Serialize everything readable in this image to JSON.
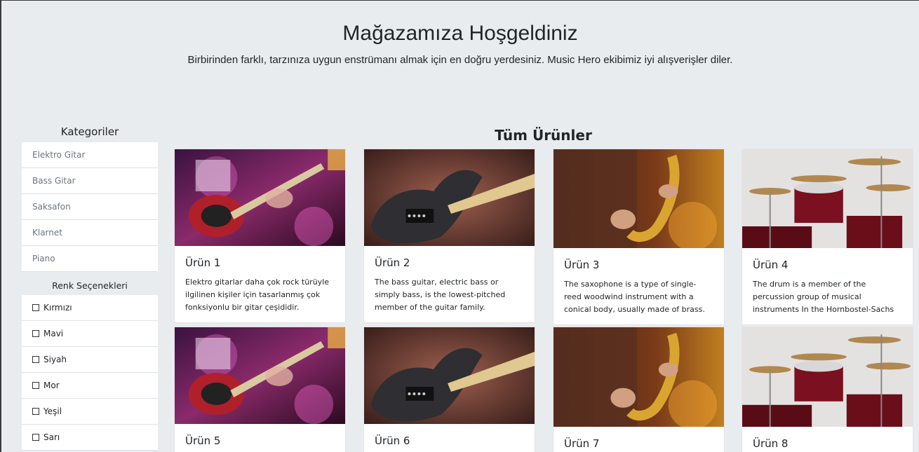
{
  "hero": {
    "title": "Mağazamıza Hoşgeldiniz",
    "subtitle": "Birbirinden farklı, tarzınıza uygun enstrümanı almak için en doğru yerdesiniz. Music Hero ekibimiz iyi alışverişler diler."
  },
  "sidebar": {
    "categories_title": "Kategoriler",
    "categories": [
      "Elektro Gitar",
      "Bass Gitar",
      "Saksafon",
      "Klarnet",
      "Piano"
    ],
    "colors_title": "Renk Seçenekleri",
    "colors": [
      "Kırmızı",
      "Mavi",
      "Siyah",
      "Mor",
      "Yeşil",
      "Sarı"
    ]
  },
  "main": {
    "title": "Tüm Ürünler",
    "products": [
      {
        "title": "Ürün 1",
        "text": "Elektro gitarlar daha çok rock türüyle ilgilinen kişiler için tasarlanmış çok fonksiyonlu bir gitar çeşididir.",
        "image": "electric-guitar-image"
      },
      {
        "title": "Ürün 2",
        "text": "The bass guitar, electric bass or simply bass, is the lowest-pitched member of the guitar family.",
        "image": "bass-guitar-image"
      },
      {
        "title": "Ürün 3",
        "text": "The saxophone is a type of single-reed woodwind instrument with a conical body, usually made of brass.",
        "image": "saxophone-image"
      },
      {
        "title": "Ürün 4",
        "text": "The drum is a member of the percussion group of musical instruments In the Hornbostel-Sachs",
        "image": "drum-kit-image"
      },
      {
        "title": "Ürün 5",
        "text": "",
        "image": "electric-guitar-image"
      },
      {
        "title": "Ürün 6",
        "text": "",
        "image": "bass-guitar-image"
      },
      {
        "title": "Ürün 7",
        "text": "",
        "image": "saxophone-image"
      },
      {
        "title": "Ürün 8",
        "text": "",
        "image": "drum-kit-image"
      }
    ]
  }
}
